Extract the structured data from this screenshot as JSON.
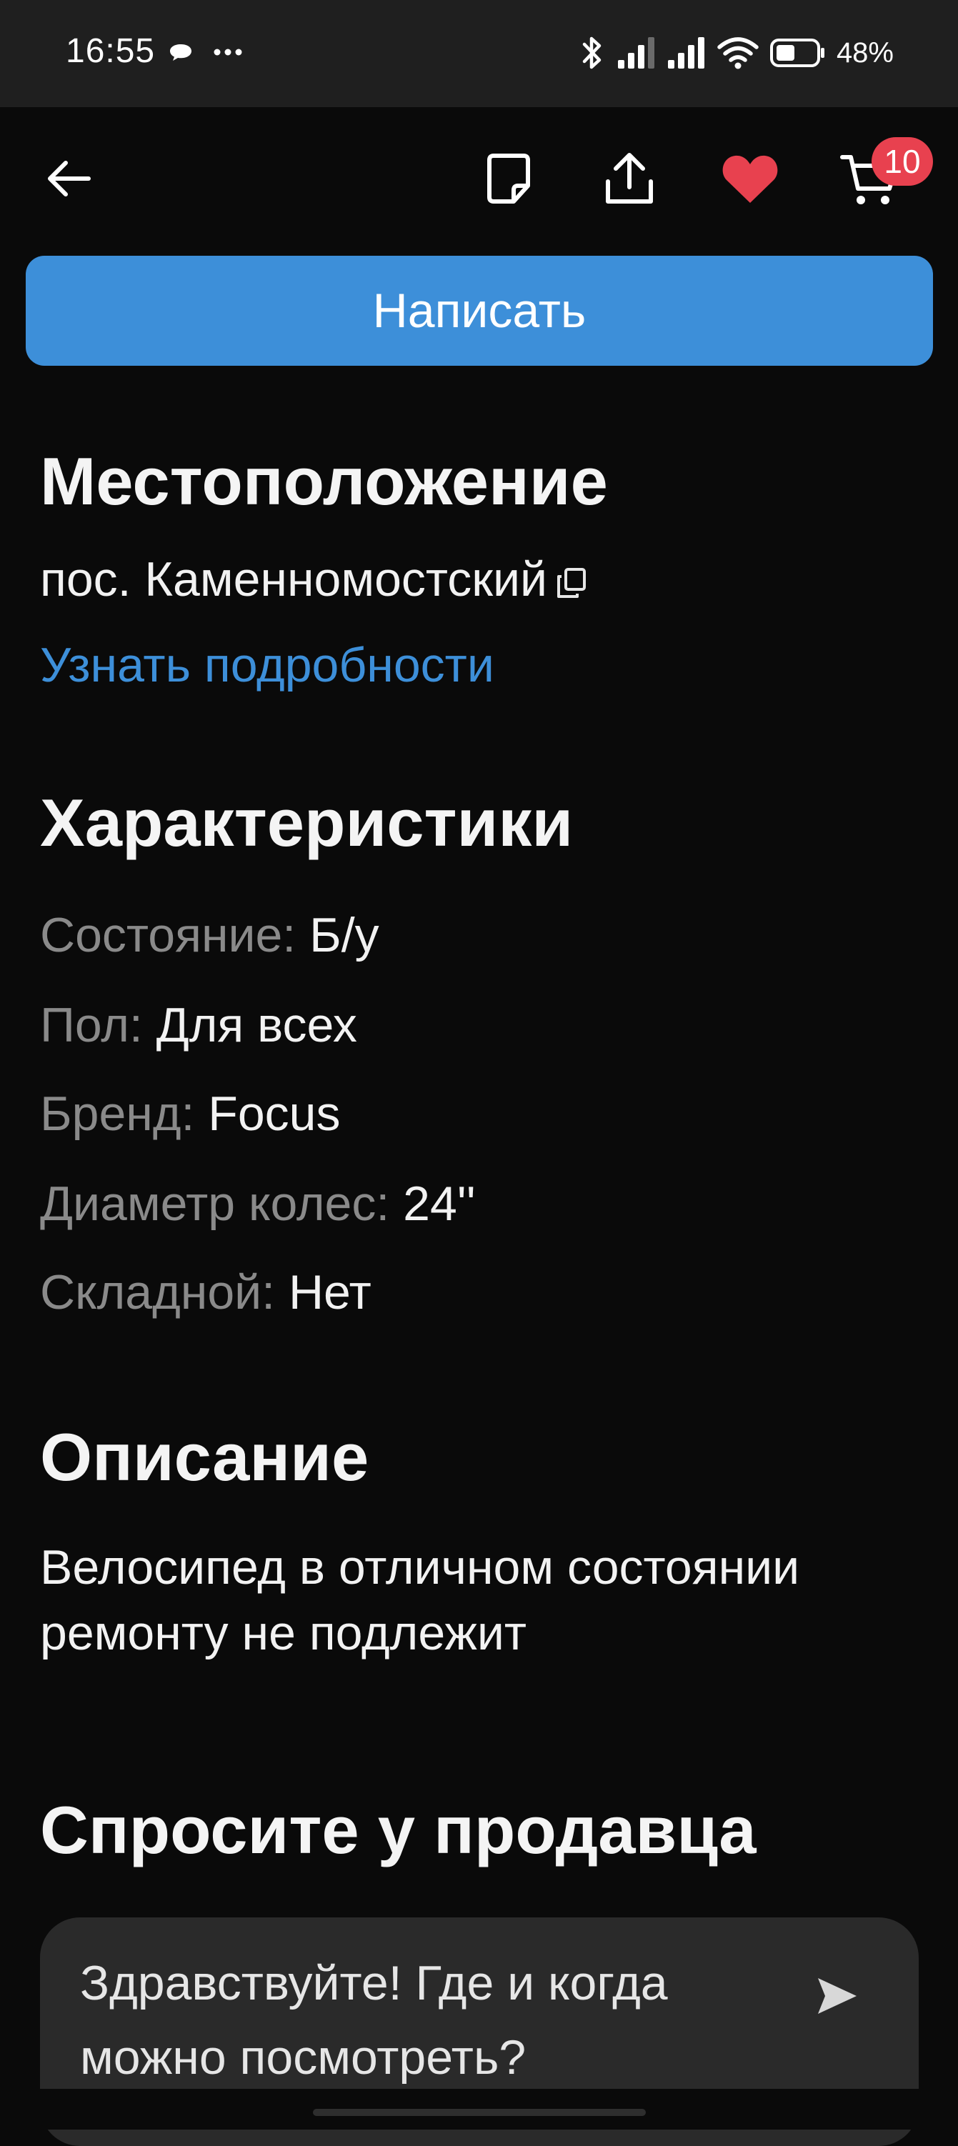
{
  "status_bar": {
    "time": "16:55",
    "battery_percent": "48%",
    "battery_level": 0.48
  },
  "app_bar": {
    "cart_badge_count": "10",
    "favorite_color": "#e8414f"
  },
  "actions": {
    "write_label": "Написать",
    "write_color": "#3d8fd9"
  },
  "location": {
    "title": "Местоположение",
    "address": "пос. Каменномостский",
    "details_link": "Узнать подробности"
  },
  "characteristics": {
    "title": "Характеристики",
    "items": [
      {
        "label": "Состояние:",
        "value": "Б/у"
      },
      {
        "label": "Пол:",
        "value": "Для всех"
      },
      {
        "label": "Бренд:",
        "value": "Focus"
      },
      {
        "label": "Диаметр колес:",
        "value": "24''"
      },
      {
        "label": "Складной:",
        "value": "Нет"
      }
    ]
  },
  "description": {
    "title": "Описание",
    "text": "Велосипед в отличном состоянии ремонту не подлежит"
  },
  "ask_seller": {
    "title": "Спросите у продавца",
    "message": "Здравствуйте! Где и когда можно посмотреть?"
  },
  "icons": {
    "back": "arrow-left-icon",
    "note": "note-icon",
    "share": "share-icon",
    "favorite": "heart-icon",
    "cart": "cart-icon",
    "copy": "copy-icon",
    "send": "send-icon"
  }
}
